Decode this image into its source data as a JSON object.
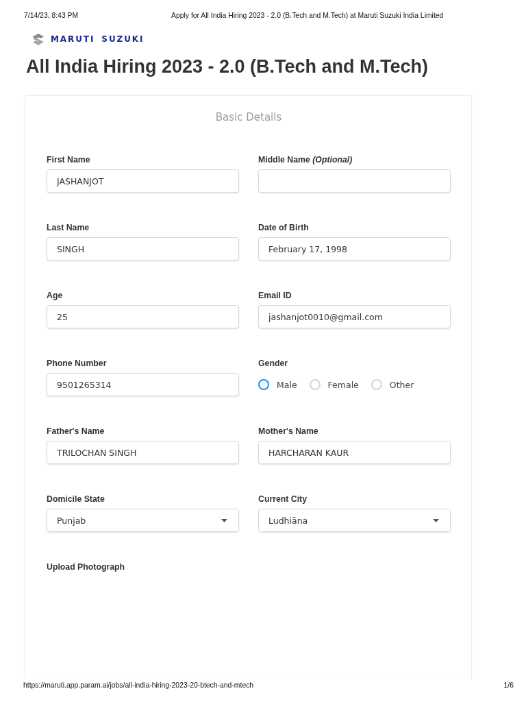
{
  "print_header": {
    "date": "7/14/23, 8:43 PM",
    "title": "Apply for All India Hiring 2023 - 2.0 (B.Tech and M.Tech) at Maruti Suzuki India Limited"
  },
  "logo": {
    "wordmark": "MARUTI SUZUKI"
  },
  "page_title": "All India Hiring 2023 - 2.0 (B.Tech and M.Tech)",
  "form": {
    "section_title": "Basic Details",
    "fields": [
      {
        "kind": "text",
        "label": "First Name",
        "value": "JASHANJOT"
      },
      {
        "kind": "text",
        "label": "Middle Name *(Optional)*"
      },
      {
        "kind": "text",
        "label": "Last Name",
        "value": "SINGH"
      },
      {
        "kind": "text",
        "label": "Date of Birth",
        "value": "February 17, 1998"
      },
      {
        "kind": "text",
        "label": "Age",
        "value": "25"
      },
      {
        "kind": "text",
        "label": "Email ID",
        "value": "jashanjot0010@gmail.com"
      },
      {
        "kind": "text",
        "label": "Phone Number",
        "value": "9501265314"
      },
      {
        "kind": "radio",
        "label": "Gender",
        "options": [
          {
            "label": "Male",
            "selected": false,
            "color": "#1890ff"
          },
          {
            "label": "Female",
            "selected": false,
            "color": "#d4d4d4"
          },
          {
            "label": "Other",
            "selected": false,
            "color": "#d4d4d4"
          }
        ]
      },
      {
        "kind": "text",
        "label": "Father's Name",
        "value": "TRILOCHAN SINGH"
      },
      {
        "kind": "text",
        "label": "Mother's Name",
        "value": "HARCHARAN KAUR"
      },
      {
        "kind": "select",
        "label": "Domicile State",
        "value": "Punjab"
      },
      {
        "kind": "select",
        "label": "Current City",
        "value": "Ludhiāna"
      },
      {
        "kind": "upload",
        "label": "Upload Photograph"
      }
    ]
  },
  "print_footer": {
    "url": "https://maruti.app.param.ai/jobs/all-india-hiring-2023-20-btech-and-mtech",
    "page": "1/6"
  }
}
